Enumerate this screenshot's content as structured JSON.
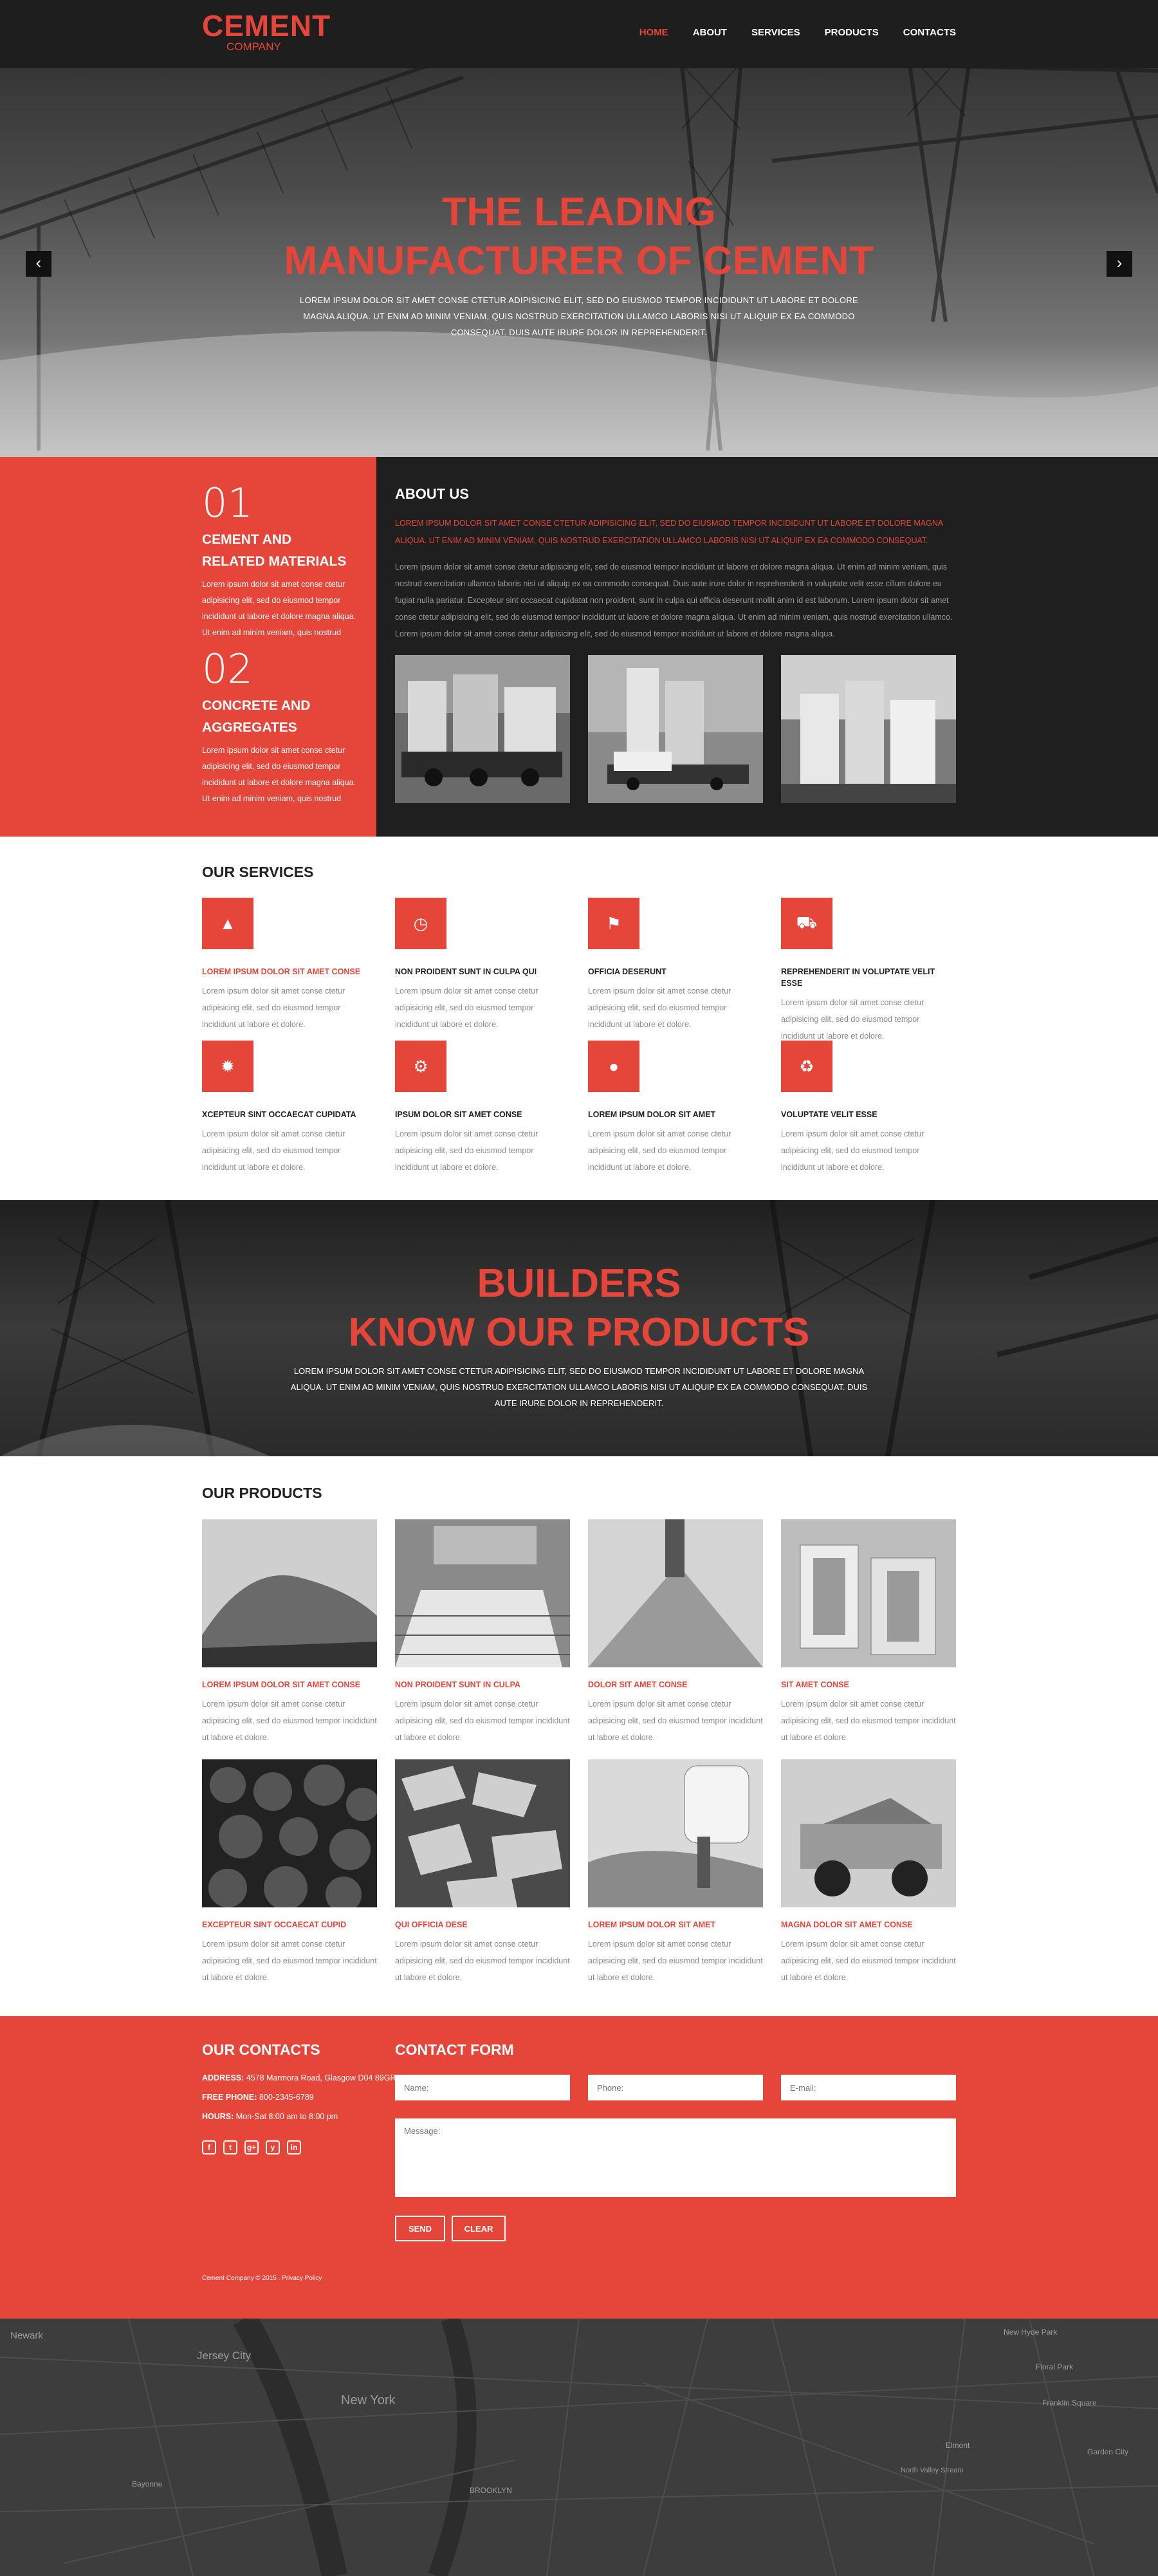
{
  "header": {
    "logo_main": "CEMENT",
    "logo_sub": "COMPANY",
    "nav": [
      "HOME",
      "ABOUT",
      "SERVICES",
      "PRODUCTS",
      "CONTACTS"
    ]
  },
  "hero": {
    "title_line1": "THE LEADING",
    "title_line2": "MANUFACTURER OF CEMENT",
    "text": "LOREM IPSUM DOLOR SIT AMET CONSE CTETUR ADIPISICING ELIT, SED DO EIUSMOD TEMPOR INCIDIDUNT UT LABORE ET DOLORE MAGNA ALIQUA. UT ENIM AD MINIM VENIAM, QUIS NOSTRUD EXERCITATION ULLAMCO LABORIS NISI UT ALIQUIP EX EA COMMODO CONSEQUAT. DUIS AUTE IRURE DOLOR IN REPREHENDERIT.",
    "prev_arrow": "‹",
    "next_arrow": "›"
  },
  "features": [
    {
      "number": "01",
      "title": "CEMENT AND RELATED MATERIALS",
      "text": "Lorem ipsum dolor sit amet conse ctetur adipisicing elit, sed do eiusmod tempor incididunt ut labore et dolore magna aliqua. Ut enim ad minim veniam, quis nostrud"
    },
    {
      "number": "02",
      "title": "CONCRETE AND AGGREGATES",
      "text": "Lorem ipsum dolor sit amet conse ctetur adipisicing elit, sed do eiusmod tempor incididunt ut labore et dolore magna aliqua. Ut enim ad minim veniam, quis nostrud"
    }
  ],
  "about": {
    "title": "ABOUT US",
    "lead": "LOREM IPSUM DOLOR SIT AMET CONSE CTETUR ADIPISICING ELIT, SED DO EIUSMOD TEMPOR INCIDIDUNT UT LABORE ET DOLORE MAGNA ALIQUA. UT ENIM AD MINIM VENIAM, QUIS NOSTRUD EXERCITATION ULLAMCO LABORIS NISI UT ALIQUIP EX EA COMMODO CONSEQUAT.",
    "text": "Lorem ipsum dolor sit amet conse ctetur adipisicing elit, sed do eiusmod tempor incididunt ut labore et dolore magna aliqua. Ut enim ad minim veniam, quis nostrud exercitation ullamco laboris nisi ut aliquip ex ea commodo consequat. Duis aute irure dolor in reprehenderit in voluptate velit esse cillum dolore eu fugiat nulla pariatur. Excepteur sint occaecat cupidatat non proident, sunt in culpa qui officia deserunt mollit anim id est laborum. Lorem ipsum dolor sit amet conse ctetur adipisicing elit, sed do eiusmod tempor incididunt ut labore et dolore magna aliqua. Ut enim ad minim veniam, quis nostrud exercitation ullamco. Lorem ipsum dolor sit amet conse ctetur adipisicing elit, sed do eiusmod tempor incididunt ut labore et dolore magna aliqua."
  },
  "services": {
    "title": "OUR SERVICES",
    "text": "Lorem ipsum dolor sit amet conse ctetur adipisicing elit, sed do eiusmod tempor incididunt ut labore et dolore.",
    "items": [
      {
        "title": "LOREM IPSUM DOLOR SIT AMET CONSE",
        "icon": "chart-icon",
        "glyph": "▲",
        "red": true
      },
      {
        "title": "NON PROIDENT SUNT IN CULPA QUI",
        "icon": "clock-icon",
        "glyph": "◷",
        "red": false
      },
      {
        "title": "OFFICIA DESERUNT",
        "icon": "flag-icon",
        "glyph": "⚑",
        "red": false
      },
      {
        "title": "REPREHENDERIT IN VOLUPTATE VELIT ESSE",
        "icon": "truck-icon",
        "glyph": "⛟",
        "red": false
      },
      {
        "title": "XCEPTEUR SINT OCCAECAT CUPIDATA",
        "icon": "gear-icon",
        "glyph": "✹",
        "red": false
      },
      {
        "title": "IPSUM DOLOR SIT AMET CONSE",
        "icon": "cogs-icon",
        "glyph": "⚙",
        "red": false
      },
      {
        "title": "LOREM IPSUM DOLOR SIT AMET",
        "icon": "drop-icon",
        "glyph": "●",
        "red": false
      },
      {
        "title": "VOLUPTATE VELIT ESSE",
        "icon": "recycle-icon",
        "glyph": "♻",
        "red": false
      }
    ]
  },
  "builders": {
    "title_line1": "BUILDERS",
    "title_line2": "KNOW OUR PRODUCTS",
    "text": "LOREM IPSUM DOLOR SIT AMET CONSE CTETUR ADIPISICING ELIT, SED DO EIUSMOD TEMPOR INCIDIDUNT UT LABORE ET DOLORE MAGNA ALIQUA. UT ENIM AD MINIM VENIAM, QUIS NOSTRUD EXERCITATION ULLAMCO LABORIS NISI UT ALIQUIP EX EA COMMODO CONSEQUAT. DUIS AUTE IRURE DOLOR IN REPREHENDERIT."
  },
  "products": {
    "title": "OUR PRODUCTS",
    "text": "Lorem ipsum dolor sit amet conse ctetur adipisicing elit, sed do eiusmod tempor incididunt ut labore et dolore.",
    "items": [
      {
        "title": "LOREM IPSUM DOLOR SIT AMET CONSE"
      },
      {
        "title": "NON PROIDENT  SUNT IN CULPA"
      },
      {
        "title": "DOLOR SIT AMET CONSE"
      },
      {
        "title": "SIT AMET CONSE"
      },
      {
        "title": "EXCEPTEUR SINT OCCAECAT CUPID"
      },
      {
        "title": "QUI OFFICIA DESE"
      },
      {
        "title": "LOREM IPSUM DOLOR SIT AMET"
      },
      {
        "title": "MAGNA DOLOR SIT AMET CONSE"
      }
    ]
  },
  "contacts": {
    "title": "OUR CONTACTS",
    "address_label": "ADDRESS:",
    "address": "4578 Marmora Road, Glasgow D04 89GR",
    "phone_label": "FREE PHONE:",
    "phone": "800-2345-6789",
    "hours_label": "HOURS:",
    "hours": "Mon-Sat 8:00 am to 8:00 pm",
    "socials": [
      "f",
      "t",
      "g+",
      "y",
      "in"
    ],
    "form_title": "CONTACT FORM",
    "name_placeholder": "Name:",
    "phone_placeholder": "Phone:",
    "email_placeholder": "E-mail:",
    "message_placeholder": "Message:",
    "send": "SEND",
    "clear": "CLEAR",
    "copyright": "Cement Company © 2015 . Privacy Policy"
  },
  "map": {
    "labels": [
      "Newark",
      "Jersey City",
      "New York",
      "BROOKLYN",
      "New Hyde Park",
      "Floral Park",
      "Franklin Square",
      "Bayonne",
      "Elmont",
      "North Valley Stream",
      "Garden City"
    ]
  },
  "colors": {
    "accent": "#e6463a",
    "dark": "#1f1f1f",
    "muted_text": "#8a8a8a"
  }
}
